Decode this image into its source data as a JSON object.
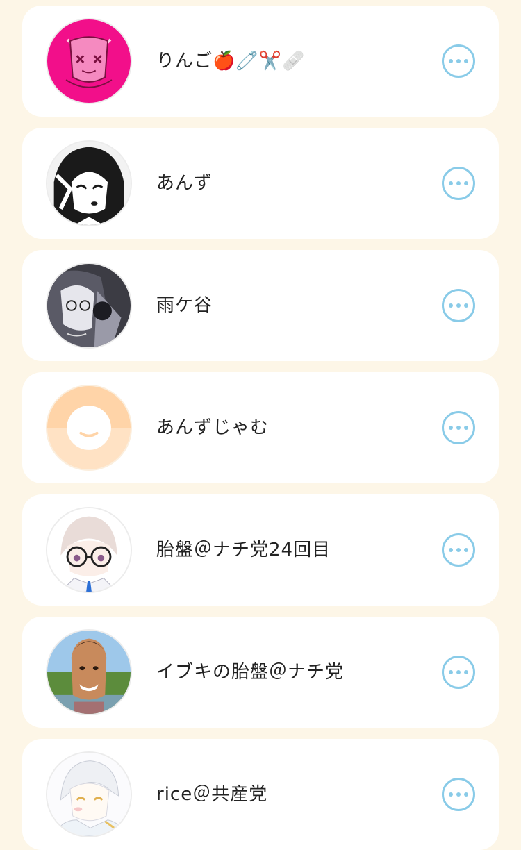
{
  "colors": {
    "background": "#fdf6e7",
    "card": "#ffffff",
    "more_icon": "#89cbe8"
  },
  "users": [
    {
      "name": "りんご🍎🧷✂️🩹",
      "avatar_icon": "pink-cat-avatar"
    },
    {
      "name": "あんず",
      "avatar_icon": "monochrome-anime-girl-avatar"
    },
    {
      "name": "雨ケ谷",
      "avatar_icon": "grayscale-anime-girl-avatar"
    },
    {
      "name": "あんずじゃむ",
      "avatar_icon": "default-smile-avatar"
    },
    {
      "name": "胎盤＠ナチ党24回目",
      "avatar_icon": "glasses-anime-avatar"
    },
    {
      "name": "イブキの胎盤＠ナチ党",
      "avatar_icon": "photo-person-avatar"
    },
    {
      "name": "rice＠共産党",
      "avatar_icon": "sketch-anime-avatar"
    }
  ]
}
